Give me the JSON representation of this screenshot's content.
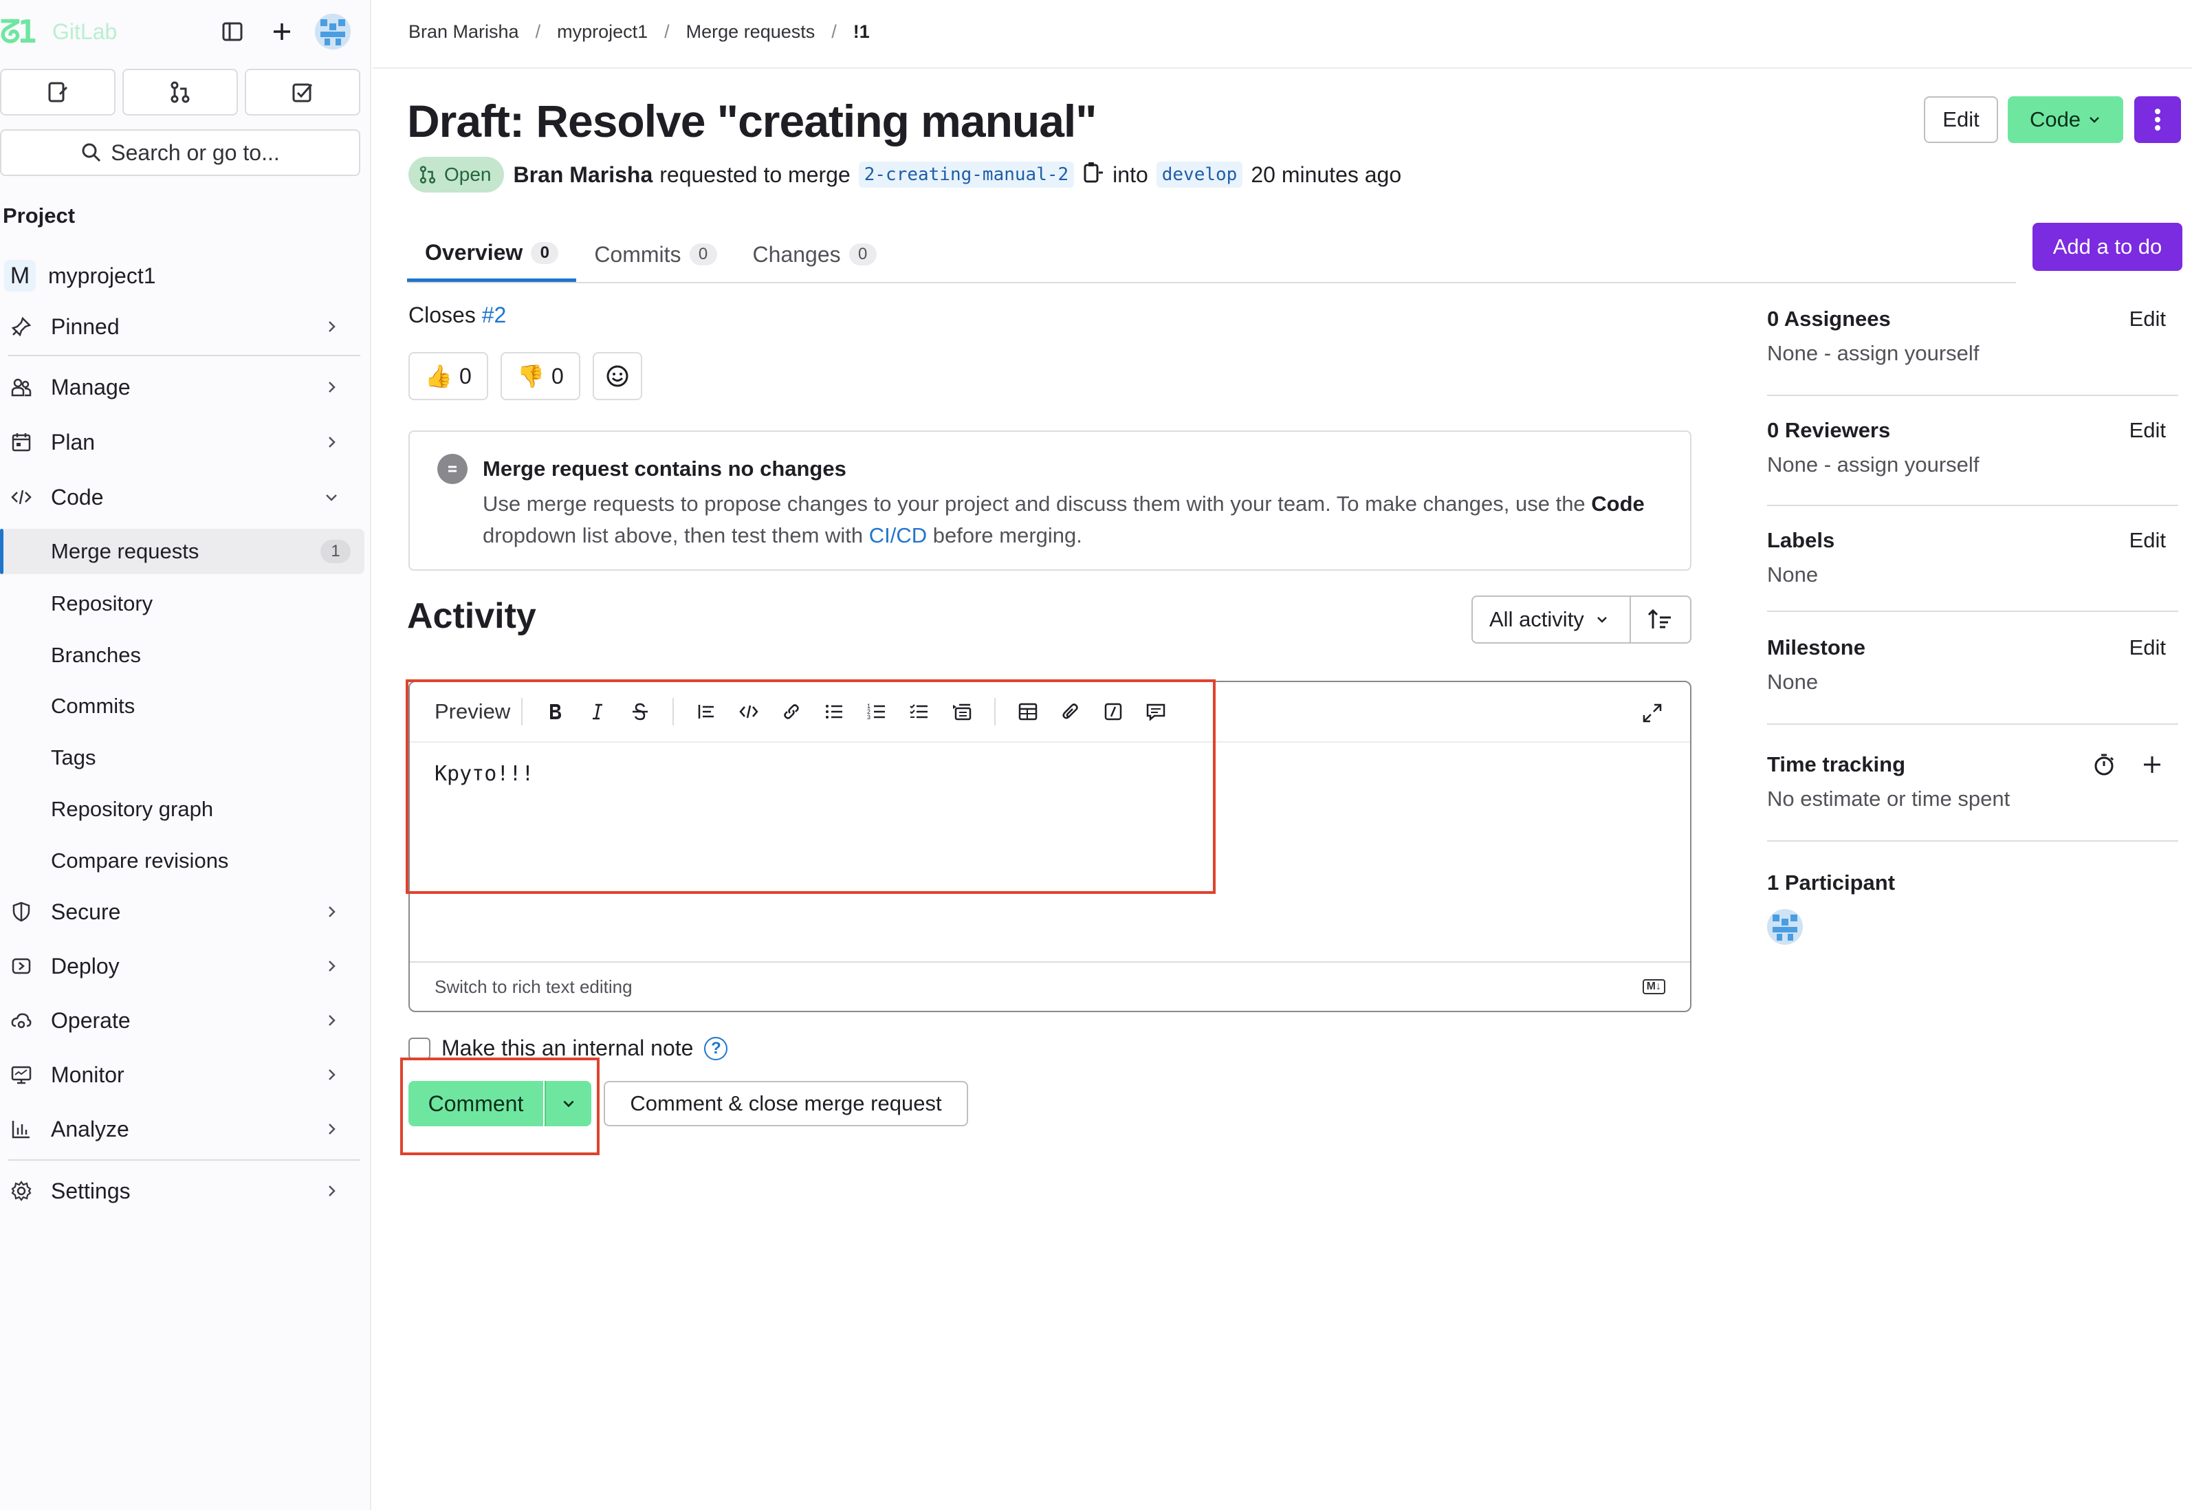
{
  "sidebar": {
    "app_name": "GitLab",
    "search_placeholder": "Search or go to...",
    "section_title": "Project",
    "project_initial": "M",
    "project_name": "myproject1",
    "items": [
      {
        "label": "Pinned"
      },
      {
        "label": "Manage"
      },
      {
        "label": "Plan"
      },
      {
        "label": "Code"
      },
      {
        "label": "Secure"
      },
      {
        "label": "Deploy"
      },
      {
        "label": "Operate"
      },
      {
        "label": "Monitor"
      },
      {
        "label": "Analyze"
      },
      {
        "label": "Settings"
      }
    ],
    "code_sub": [
      {
        "label": "Merge requests",
        "count": "1"
      },
      {
        "label": "Repository"
      },
      {
        "label": "Branches"
      },
      {
        "label": "Commits"
      },
      {
        "label": "Tags"
      },
      {
        "label": "Repository graph"
      },
      {
        "label": "Compare revisions"
      }
    ]
  },
  "breadcrumb": [
    "Bran Marisha",
    "myproject1",
    "Merge requests",
    "!1"
  ],
  "header": {
    "title": "Draft: Resolve \"creating manual\"",
    "edit_label": "Edit",
    "code_label": "Code",
    "status": "Open",
    "author": "Bran Marisha",
    "requested_text": "requested to merge",
    "source_branch": "2-creating-manual-2",
    "into_text": "into",
    "target_branch": "develop",
    "time_ago": "20 minutes ago"
  },
  "tabs": [
    {
      "label": "Overview",
      "count": "0"
    },
    {
      "label": "Commits",
      "count": "0"
    },
    {
      "label": "Changes",
      "count": "0"
    }
  ],
  "add_todo_label": "Add a to do",
  "closes": {
    "prefix": "Closes",
    "issue": "#2"
  },
  "reactions": {
    "thumbs_up": "0",
    "thumbs_down": "0"
  },
  "info": {
    "title": "Merge request contains no changes",
    "body_1": "Use merge requests to propose changes to your project and discuss them with your team. To make changes, use the ",
    "body_code": "Code",
    "body_2": " dropdown list above, then test them with ",
    "body_link": "CI/CD",
    "body_3": " before merging."
  },
  "activity": {
    "title": "Activity",
    "filter": "All activity"
  },
  "editor": {
    "preview_label": "Preview",
    "content": "Круто!!!",
    "switch_label": "Switch to rich text editing",
    "md_badge": "M↓"
  },
  "internal_note_label": "Make this an internal note",
  "comment_label": "Comment",
  "comment_close_label": "Comment & close merge request",
  "right_panel": {
    "assignees": {
      "title": "0 Assignees",
      "value": "None - assign yourself",
      "edit": "Edit"
    },
    "reviewers": {
      "title": "0 Reviewers",
      "value": "None - assign yourself",
      "edit": "Edit"
    },
    "labels": {
      "title": "Labels",
      "value": "None",
      "edit": "Edit"
    },
    "milestone": {
      "title": "Milestone",
      "value": "None",
      "edit": "Edit"
    },
    "time_tracking": {
      "title": "Time tracking",
      "value": "No estimate or time spent"
    },
    "participants": {
      "title": "1 Participant"
    }
  },
  "colors": {
    "accent_green": "#6fe6a0",
    "accent_purple": "#7b2be0",
    "link_blue": "#1f75cb",
    "highlight_red": "#e0422e"
  }
}
